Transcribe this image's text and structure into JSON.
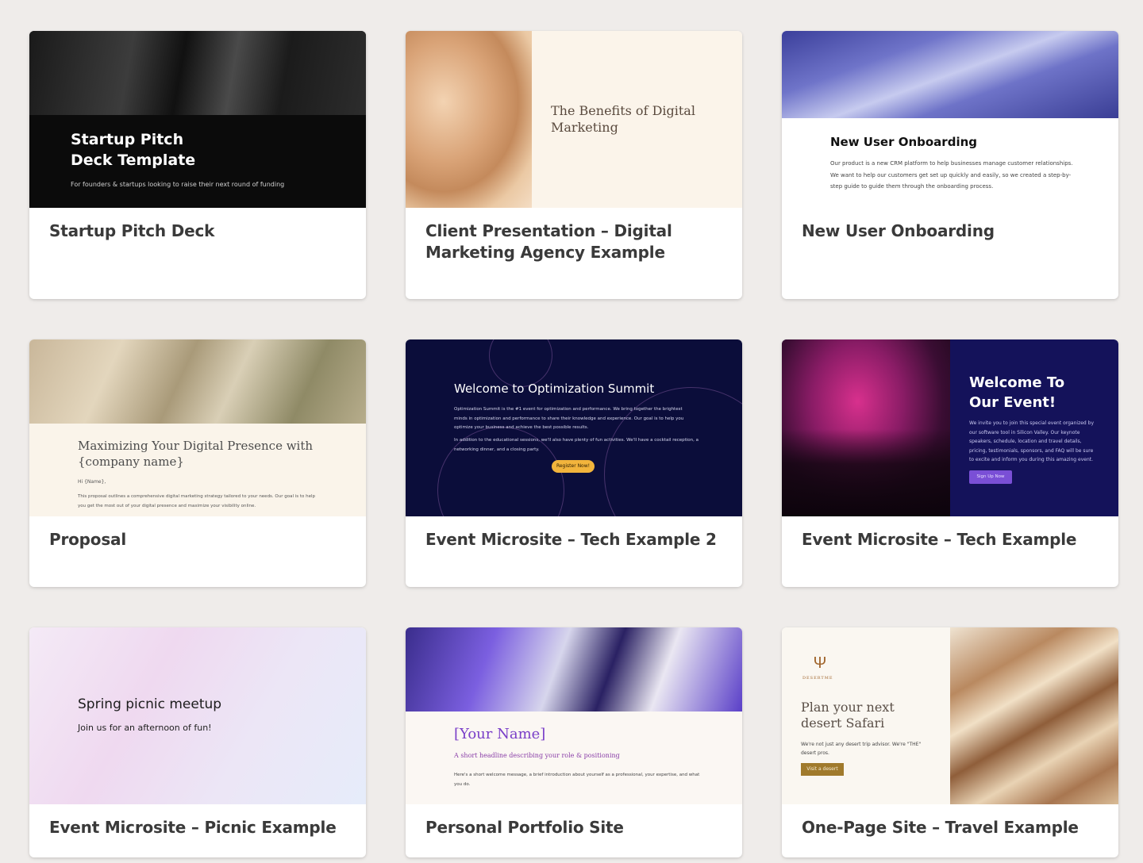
{
  "cards": [
    {
      "title": "Startup Pitch Deck",
      "thumb": {
        "heading_line1": "Startup Pitch",
        "heading_line2": "Deck Template",
        "sub": "For founders & startups looking to raise their next round of funding"
      }
    },
    {
      "title": "Client Presentation – Digital Marketing Agency Example",
      "thumb": {
        "heading": "The Benefits of Digital Marketing"
      }
    },
    {
      "title": "New User Onboarding",
      "thumb": {
        "heading": "New User Onboarding",
        "body": "Our product is a new CRM platform to help businesses manage customer relationships. We want to help our customers get set up quickly and easily, so we created a step-by-step guide to guide them through the onboarding process."
      }
    },
    {
      "title": "Proposal",
      "thumb": {
        "heading": "Maximizing Your Digital Presence with {company name}",
        "greeting": "Hi {Name},",
        "body": "This proposal outlines a comprehensive digital marketing strategy tailored to your needs. Our goal is to help you get the most out of your digital presence and maximize your visibility online."
      }
    },
    {
      "title": "Event Microsite – Tech Example 2",
      "thumb": {
        "heading": "Welcome to Optimization Summit",
        "p1": "Optimization Summit is the #1 event for optimization and performance. We bring together the brightest minds in optimization and performance to share their knowledge and experience. Our goal is to help you optimize your business and achieve the best possible results.",
        "p2": "In addition to the educational sessions, we'll also have plenty of fun activities. We'll have a cocktail reception, a networking dinner, and a closing party.",
        "button": "Register Now!"
      }
    },
    {
      "title": "Event Microsite – Tech Example",
      "thumb": {
        "heading_line1": "Welcome To",
        "heading_line2": "Our Event!",
        "body": "We invite you to join this special event organized by our software tool in Silicon Valley. Our keynote speakers, schedule, location and travel details, pricing, testimonials, sponsors, and FAQ will be sure to excite and inform you during this amazing event.",
        "button": "Sign Up Now"
      }
    },
    {
      "title": "Event Microsite – Picnic Example",
      "thumb": {
        "heading": "Spring picnic meetup",
        "sub": "Join us for an afternoon of fun!"
      }
    },
    {
      "title": "Personal Portfolio Site",
      "thumb": {
        "heading": "[Your Name]",
        "headline": "A short headline describing your role & positioning",
        "body": "Here's a short welcome message, a brief introduction about yourself as a professional, your expertise, and what you do."
      }
    },
    {
      "title": "One-Page Site – Travel Example",
      "thumb": {
        "logo_text": "DESERTME",
        "heading": "Plan your next desert Safari",
        "body": "We're not just any desert trip advisor. We're \"THE\" desert pros.",
        "button": "Visit a desert"
      }
    }
  ]
}
